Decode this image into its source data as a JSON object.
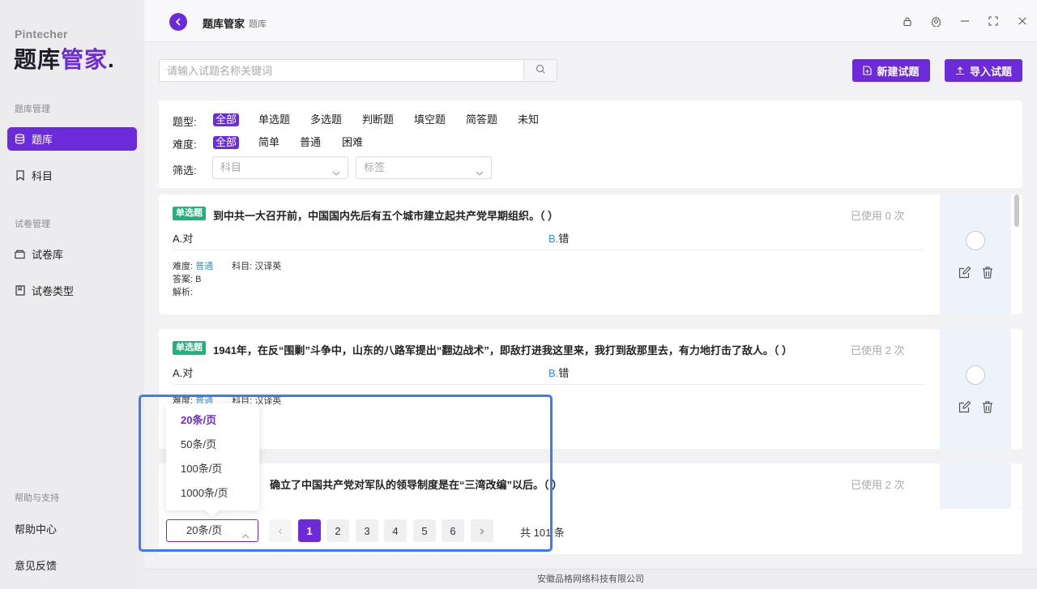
{
  "brand": {
    "small": "Pintecher",
    "big_prefix": "题库",
    "big_accent": "管家",
    "big_dot": "."
  },
  "sidebar": {
    "sections": [
      {
        "title": "题库管理",
        "items": [
          {
            "label": "题库",
            "icon": "database-icon",
            "active": true
          },
          {
            "label": "科目",
            "icon": "bookmark-icon",
            "active": false
          }
        ]
      },
      {
        "title": "试卷管理",
        "items": [
          {
            "label": "试卷库",
            "icon": "folder-icon",
            "active": false
          },
          {
            "label": "试卷类型",
            "icon": "book-icon",
            "active": false
          }
        ]
      },
      {
        "title": "帮助与支持",
        "items": [
          {
            "label": "帮助中心"
          },
          {
            "label": "意见反馈"
          }
        ]
      }
    ]
  },
  "topbar": {
    "title": "题库管家",
    "subtitle": "题库",
    "icons": [
      "lock-icon",
      "gear-icon",
      "minimize-icon",
      "fullscreen-icon",
      "close-icon"
    ]
  },
  "search": {
    "placeholder": "请输入试题名称关键词",
    "value": ""
  },
  "buttons": {
    "new_question": "新建试题",
    "import_question": "导入试题"
  },
  "filters": {
    "type_label": "题型:",
    "types": [
      "全部",
      "单选题",
      "多选题",
      "判断题",
      "填空题",
      "简答题",
      "未知"
    ],
    "difficulty_label": "难度:",
    "difficulties": [
      "全部",
      "简单",
      "普通",
      "困难"
    ],
    "filter_label": "筛选:",
    "subject_placeholder": "科目",
    "tag_placeholder": "标签"
  },
  "questions": [
    {
      "badge": "单选题",
      "text": "到中共一大召开前，中国国内先后有五个城市建立起共产党早期组织。（    ）",
      "used": "已使用 0 次",
      "option_a": "A.对",
      "option_b_key": "B.",
      "option_b_val": "错",
      "difficulty_label": "难度:",
      "difficulty": "普通",
      "subject_label": "科目:",
      "subject": "汉译英",
      "answer_label": "答案:",
      "answer": "B",
      "analysis_label": "解析:"
    },
    {
      "badge": "单选题",
      "text": "1941年，在反“围剿”斗争中，山东的八路军提出“翻边战术”，即敌打进我这里来，我打到敌那里去，有力地打击了敌人。（    ）",
      "used": "已使用 2 次",
      "option_a": "A.对",
      "option_b_key": "B.",
      "option_b_val": "错",
      "difficulty_label": "难度:",
      "difficulty": "普通",
      "subject_label": "科目:",
      "subject": "汉译英"
    },
    {
      "text": "确立了中国共产党对军队的领导制度是在“三湾改编”以后。（    ）",
      "used": "已使用 2 次"
    }
  ],
  "pagination": {
    "page_size": "20条/页",
    "pages": [
      "1",
      "2",
      "3",
      "4",
      "5",
      "6"
    ],
    "current": "1",
    "total": "共 101 条",
    "size_options": [
      "20条/页",
      "50条/页",
      "100条/页",
      "1000条/页"
    ]
  },
  "footer": "安徽品格网络科技有限公司"
}
